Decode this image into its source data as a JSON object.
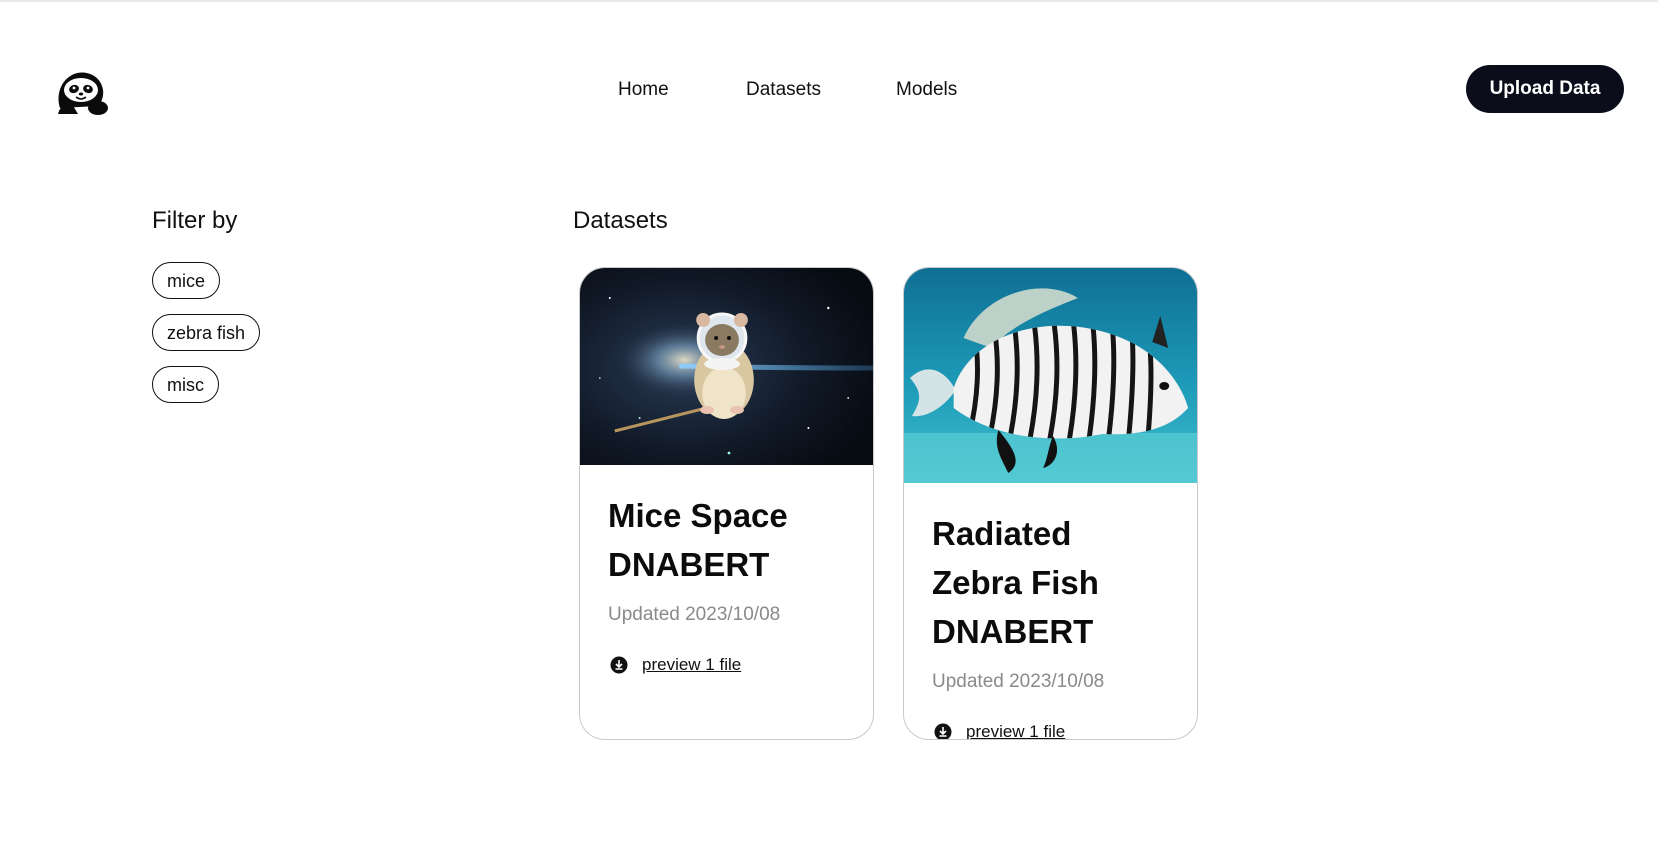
{
  "header": {
    "logo": "sloth-logo-icon",
    "nav": [
      {
        "label": "Home"
      },
      {
        "label": "Datasets"
      },
      {
        "label": "Models"
      }
    ],
    "upload_button": "Upload Data"
  },
  "filters": {
    "title": "Filter by",
    "chips": [
      "mice",
      "zebra fish",
      "misc"
    ]
  },
  "datasets": {
    "title": "Datasets",
    "cards": [
      {
        "image": "mouse-astronaut-in-space",
        "title": "Mice Space DNABERT",
        "updated": "Updated 2023/10/08",
        "link_icon": "download-circle-icon",
        "link": "preview 1 file"
      },
      {
        "image": "zebra-fish-underwater",
        "title": "Radiated Zebra Fish DNABERT",
        "updated": "Updated 2023/10/08",
        "link_icon": "download-circle-icon",
        "link": "preview 1 file"
      }
    ]
  },
  "colors": {
    "primary_button": "#0c0d1a",
    "card_border": "#c9c9c9",
    "muted_text": "#8a8a8a"
  }
}
